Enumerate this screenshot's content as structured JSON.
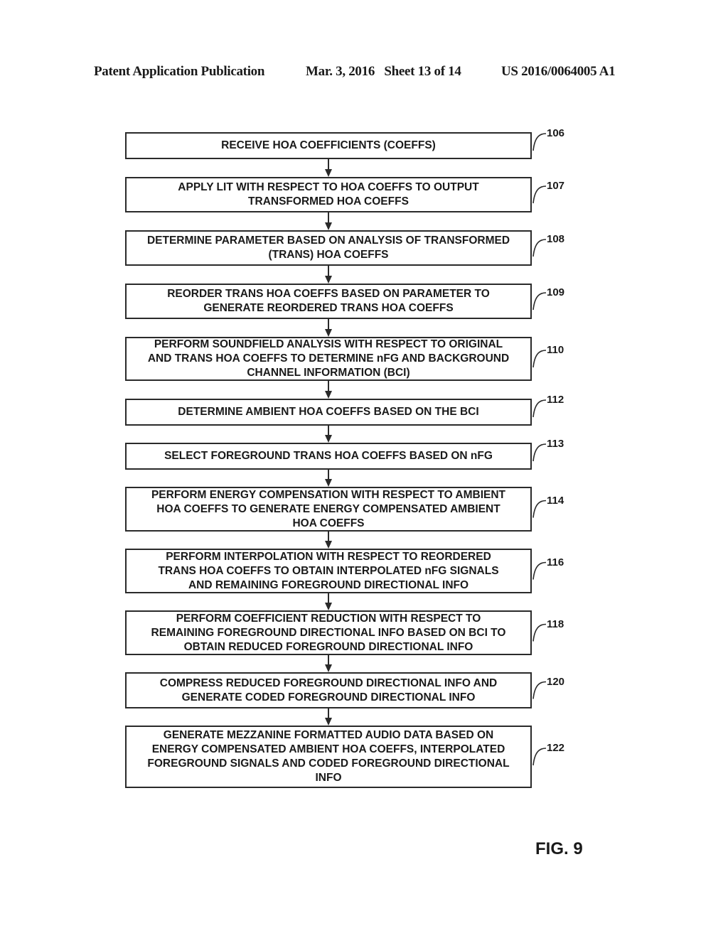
{
  "header": {
    "publication": "Patent Application Publication",
    "date_sheet": "Mar. 3, 2016   Sheet 13 of 14",
    "patent_number": "US 2016/0064005 A1"
  },
  "flowchart": {
    "steps": [
      {
        "ref": "106",
        "text": "RECEIVE HOA COEFFICIENTS (COEFFS)"
      },
      {
        "ref": "107",
        "text": "APPLY LIT WITH RESPECT TO HOA COEFFS TO OUTPUT\nTRANSFORMED HOA COEFFS"
      },
      {
        "ref": "108",
        "text": "DETERMINE PARAMETER BASED ON ANALYSIS OF TRANSFORMED\n(TRANS) HOA COEFFS"
      },
      {
        "ref": "109",
        "text": "REORDER TRANS HOA COEFFS BASED ON PARAMETER TO\nGENERATE REORDERED TRANS HOA COEFFS"
      },
      {
        "ref": "110",
        "text": "PERFORM SOUNDFIELD ANALYSIS WITH RESPECT TO ORIGINAL\nAND TRANS HOA COEFFS TO DETERMINE nFG AND BACKGROUND\nCHANNEL INFORMATION (BCI)"
      },
      {
        "ref": "112",
        "text": "DETERMINE AMBIENT HOA COEFFS BASED ON THE BCI"
      },
      {
        "ref": "113",
        "text": "SELECT FOREGROUND TRANS HOA COEFFS BASED ON nFG"
      },
      {
        "ref": "114",
        "text": "PERFORM ENERGY COMPENSATION WITH RESPECT TO AMBIENT\nHOA COEFFS TO GENERATE ENERGY COMPENSATED AMBIENT\nHOA COEFFS"
      },
      {
        "ref": "116",
        "text": "PERFORM  INTERPOLATION WITH RESPECT TO REORDERED\nTRANS HOA COEFFS TO OBTAIN INTERPOLATED nFG SIGNALS\nAND REMAINING FOREGROUND DIRECTIONAL INFO"
      },
      {
        "ref": "118",
        "text": "PERFORM COEFFICIENT REDUCTION WITH RESPECT TO\nREMAINING FOREGROUND DIRECTIONAL INFO BASED ON BCI TO\nOBTAIN REDUCED FOREGROUND DIRECTIONAL INFO"
      },
      {
        "ref": "120",
        "text": "COMPRESS REDUCED FOREGROUND DIRECTIONAL INFO AND\nGENERATE CODED FOREGROUND DIRECTIONAL INFO"
      },
      {
        "ref": "122",
        "text": "GENERATE MEZZANINE FORMATTED AUDIO DATA BASED ON\nENERGY COMPENSATED AMBIENT HOA COEFFS, INTERPOLATED\nFOREGROUND SIGNALS AND CODED FOREGROUND DIRECTIONAL\nINFO"
      }
    ]
  },
  "figure_label": "FIG. 9"
}
